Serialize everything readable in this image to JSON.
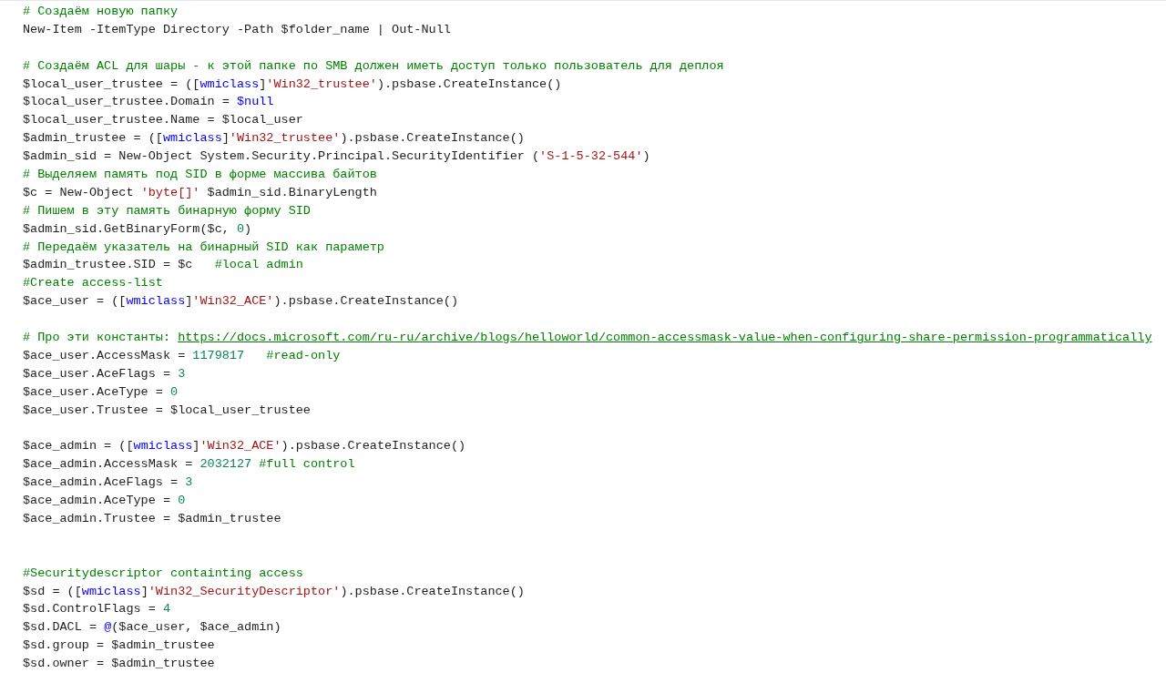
{
  "code_lines": [
    {
      "kind": "code",
      "tokens": [
        {
          "kind": "comment",
          "text": "# Создаём новую папку"
        }
      ]
    },
    {
      "kind": "code",
      "tokens": [
        {
          "kind": "plain",
          "text": "New-Item -ItemType Directory -Path $folder_name | Out-Null"
        }
      ]
    },
    {
      "kind": "blank"
    },
    {
      "kind": "code",
      "tokens": [
        {
          "kind": "comment",
          "text": "# Создаём ACL для шары - к этой папке по SMB должен иметь доступ только пользователь для деплоя"
        }
      ]
    },
    {
      "kind": "code",
      "tokens": [
        {
          "kind": "plain",
          "text": "$local_user_trustee = (["
        },
        {
          "kind": "keyword",
          "text": "wmiclass"
        },
        {
          "kind": "plain",
          "text": "]"
        },
        {
          "kind": "string",
          "text": "'Win32_trustee'"
        },
        {
          "kind": "plain",
          "text": ").psbase.CreateInstance()"
        }
      ]
    },
    {
      "kind": "code",
      "tokens": [
        {
          "kind": "plain",
          "text": "$local_user_trustee.Domain = "
        },
        {
          "kind": "keyword",
          "text": "$null"
        }
      ]
    },
    {
      "kind": "code",
      "tokens": [
        {
          "kind": "plain",
          "text": "$local_user_trustee.Name = $local_user"
        }
      ]
    },
    {
      "kind": "code",
      "tokens": [
        {
          "kind": "plain",
          "text": "$admin_trustee = (["
        },
        {
          "kind": "keyword",
          "text": "wmiclass"
        },
        {
          "kind": "plain",
          "text": "]"
        },
        {
          "kind": "string",
          "text": "'Win32_trustee'"
        },
        {
          "kind": "plain",
          "text": ").psbase.CreateInstance()"
        }
      ]
    },
    {
      "kind": "code",
      "tokens": [
        {
          "kind": "plain",
          "text": "$admin_sid = New-Object System.Security.Principal.SecurityIdentifier ("
        },
        {
          "kind": "string",
          "text": "'S-1-5-32-544'"
        },
        {
          "kind": "plain",
          "text": ")"
        }
      ]
    },
    {
      "kind": "code",
      "tokens": [
        {
          "kind": "comment",
          "text": "# Выделяем память под SID в форме массива байтов"
        }
      ]
    },
    {
      "kind": "code",
      "tokens": [
        {
          "kind": "plain",
          "text": "$c = New-Object "
        },
        {
          "kind": "string",
          "text": "'byte[]'"
        },
        {
          "kind": "plain",
          "text": " $admin_sid.BinaryLength"
        }
      ]
    },
    {
      "kind": "code",
      "tokens": [
        {
          "kind": "comment",
          "text": "# Пишем в эту память бинарную форму SID"
        }
      ]
    },
    {
      "kind": "code",
      "tokens": [
        {
          "kind": "plain",
          "text": "$admin_sid.GetBinaryForm($c, "
        },
        {
          "kind": "number",
          "text": "0"
        },
        {
          "kind": "plain",
          "text": ")"
        }
      ]
    },
    {
      "kind": "code",
      "tokens": [
        {
          "kind": "comment",
          "text": "# Передаём указатель на бинарный SID как параметр"
        }
      ]
    },
    {
      "kind": "code",
      "tokens": [
        {
          "kind": "plain",
          "text": "$admin_trustee.SID = $c   "
        },
        {
          "kind": "comment",
          "text": "#local admin"
        }
      ]
    },
    {
      "kind": "code",
      "tokens": [
        {
          "kind": "comment",
          "text": "#Create access-list"
        }
      ]
    },
    {
      "kind": "code",
      "tokens": [
        {
          "kind": "plain",
          "text": "$ace_user = (["
        },
        {
          "kind": "keyword",
          "text": "wmiclass"
        },
        {
          "kind": "plain",
          "text": "]"
        },
        {
          "kind": "string",
          "text": "'Win32_ACE'"
        },
        {
          "kind": "plain",
          "text": ").psbase.CreateInstance()"
        }
      ]
    },
    {
      "kind": "blank"
    },
    {
      "kind": "code",
      "tokens": [
        {
          "kind": "comment",
          "text": "# Про эти константы: "
        },
        {
          "kind": "link",
          "text": "https://docs.microsoft.com/ru-ru/archive/blogs/helloworld/common-accessmask-value-when-configuring-share-permission-programmatically"
        }
      ]
    },
    {
      "kind": "code",
      "tokens": [
        {
          "kind": "plain",
          "text": "$ace_user.AccessMask = "
        },
        {
          "kind": "number",
          "text": "1179817   "
        },
        {
          "kind": "comment",
          "text": "#read-only"
        }
      ]
    },
    {
      "kind": "code",
      "tokens": [
        {
          "kind": "plain",
          "text": "$ace_user.AceFlags = "
        },
        {
          "kind": "number",
          "text": "3"
        }
      ]
    },
    {
      "kind": "code",
      "tokens": [
        {
          "kind": "plain",
          "text": "$ace_user.AceType = "
        },
        {
          "kind": "number",
          "text": "0"
        }
      ]
    },
    {
      "kind": "code",
      "tokens": [
        {
          "kind": "plain",
          "text": "$ace_user.Trustee = $local_user_trustee"
        }
      ]
    },
    {
      "kind": "blank"
    },
    {
      "kind": "code",
      "tokens": [
        {
          "kind": "plain",
          "text": "$ace_admin = (["
        },
        {
          "kind": "keyword",
          "text": "wmiclass"
        },
        {
          "kind": "plain",
          "text": "]"
        },
        {
          "kind": "string",
          "text": "'Win32_ACE'"
        },
        {
          "kind": "plain",
          "text": ").psbase.CreateInstance()"
        }
      ]
    },
    {
      "kind": "code",
      "tokens": [
        {
          "kind": "plain",
          "text": "$ace_admin.AccessMask = "
        },
        {
          "kind": "number",
          "text": "2032127 "
        },
        {
          "kind": "comment",
          "text": "#full control"
        }
      ]
    },
    {
      "kind": "code",
      "tokens": [
        {
          "kind": "plain",
          "text": "$ace_admin.AceFlags = "
        },
        {
          "kind": "number",
          "text": "3"
        }
      ]
    },
    {
      "kind": "code",
      "tokens": [
        {
          "kind": "plain",
          "text": "$ace_admin.AceType = "
        },
        {
          "kind": "number",
          "text": "0"
        }
      ]
    },
    {
      "kind": "code",
      "tokens": [
        {
          "kind": "plain",
          "text": "$ace_admin.Trustee = $admin_trustee"
        }
      ]
    },
    {
      "kind": "blank"
    },
    {
      "kind": "blank"
    },
    {
      "kind": "code",
      "tokens": [
        {
          "kind": "comment",
          "text": "#Securitydescriptor containting access"
        }
      ]
    },
    {
      "kind": "code",
      "tokens": [
        {
          "kind": "plain",
          "text": "$sd = (["
        },
        {
          "kind": "keyword",
          "text": "wmiclass"
        },
        {
          "kind": "plain",
          "text": "]"
        },
        {
          "kind": "string",
          "text": "'Win32_SecurityDescriptor'"
        },
        {
          "kind": "plain",
          "text": ").psbase.CreateInstance()"
        }
      ]
    },
    {
      "kind": "code",
      "tokens": [
        {
          "kind": "plain",
          "text": "$sd.ControlFlags = "
        },
        {
          "kind": "number",
          "text": "4"
        }
      ]
    },
    {
      "kind": "code",
      "tokens": [
        {
          "kind": "plain",
          "text": "$sd.DACL = "
        },
        {
          "kind": "keyword",
          "text": "@"
        },
        {
          "kind": "plain",
          "text": "($ace_user, $ace_admin)"
        }
      ]
    },
    {
      "kind": "code",
      "tokens": [
        {
          "kind": "plain",
          "text": "$sd.group = $admin_trustee"
        }
      ]
    },
    {
      "kind": "code",
      "tokens": [
        {
          "kind": "plain",
          "text": "$sd.owner = $admin_trustee"
        }
      ]
    }
  ]
}
